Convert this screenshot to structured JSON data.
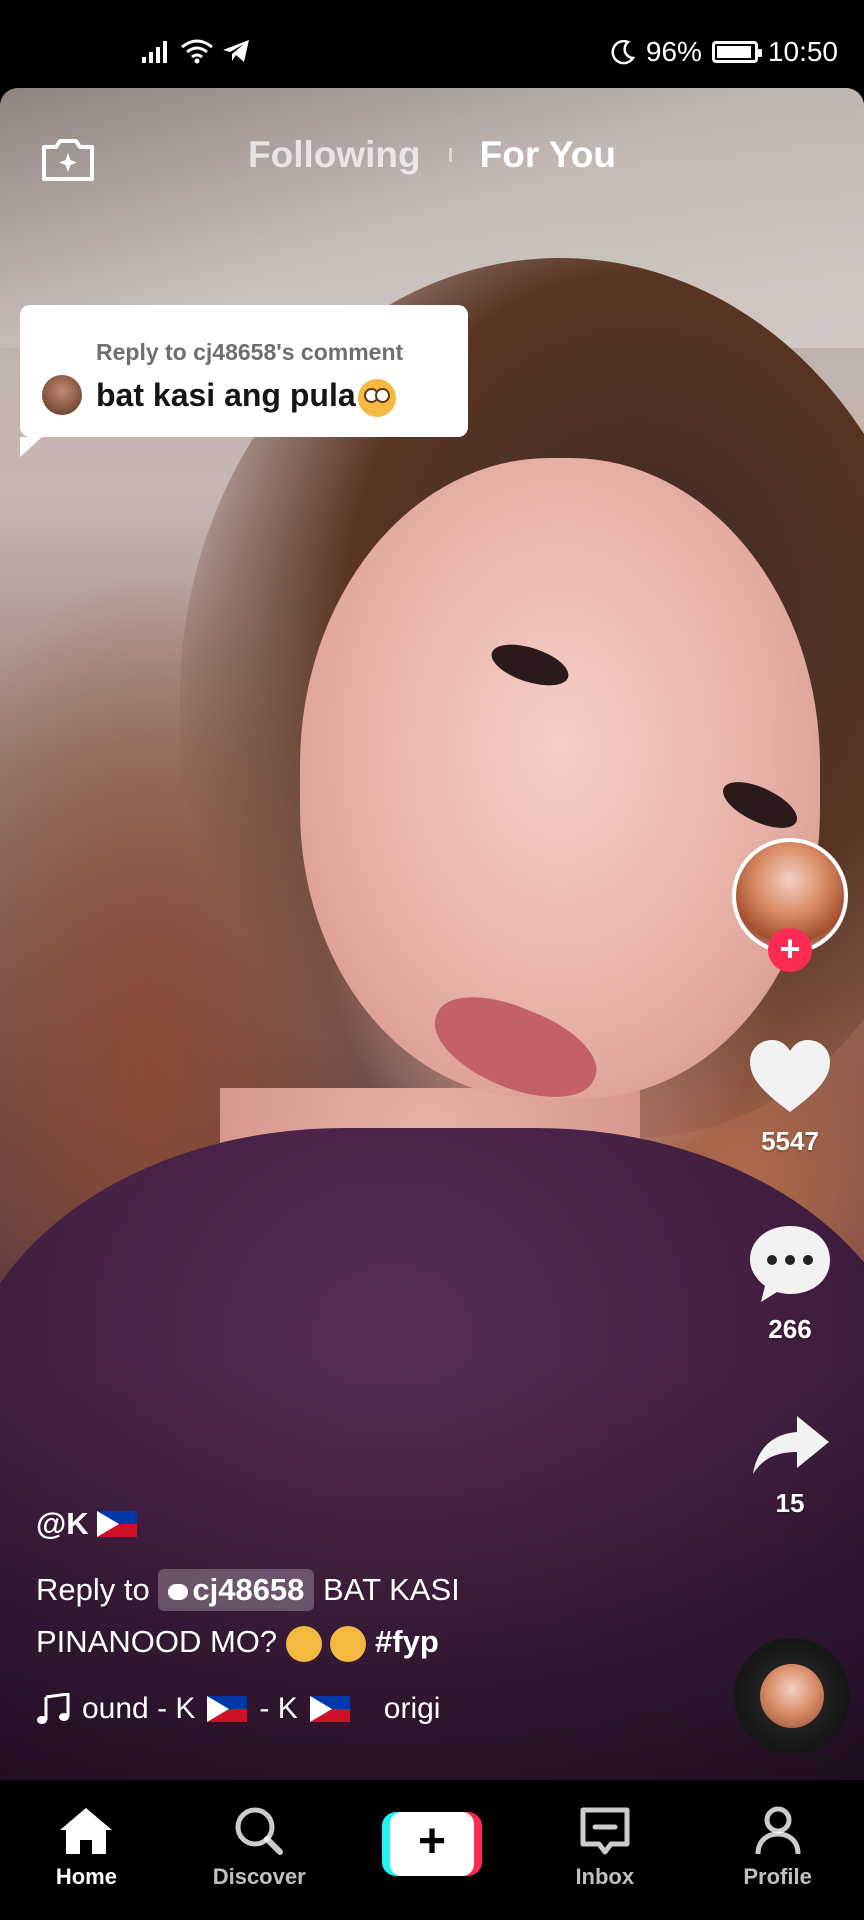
{
  "status_bar": {
    "battery": "96%",
    "time": "10:50"
  },
  "top_nav": {
    "tabs": [
      {
        "label": "Following",
        "active": false
      },
      {
        "label": "For You",
        "active": true
      }
    ]
  },
  "reply_bubble": {
    "title": "Reply to cj48658's comment",
    "text": "bat kasi ang pula"
  },
  "actions": {
    "likes": "5547",
    "comments": "266",
    "shares": "15"
  },
  "video_info": {
    "username": "@K",
    "caption_prefix": "Reply to",
    "mention": "cj48658",
    "caption_line1": "BAT KASI",
    "caption_line2": "PINANOOD MO?",
    "hashtag": "#fyp",
    "sound_part1": "ound - K",
    "sound_part2": "- K",
    "sound_part3": "origi"
  },
  "bottom_nav": {
    "items": [
      {
        "label": "Home",
        "icon": "home-icon",
        "active": true
      },
      {
        "label": "Discover",
        "icon": "search-icon",
        "active": false
      },
      {
        "label": "Inbox",
        "icon": "inbox-icon",
        "active": false
      },
      {
        "label": "Profile",
        "icon": "profile-icon",
        "active": false
      }
    ]
  },
  "colors": {
    "accent_red": "#fe2c55",
    "accent_cyan": "#25f4ee"
  }
}
